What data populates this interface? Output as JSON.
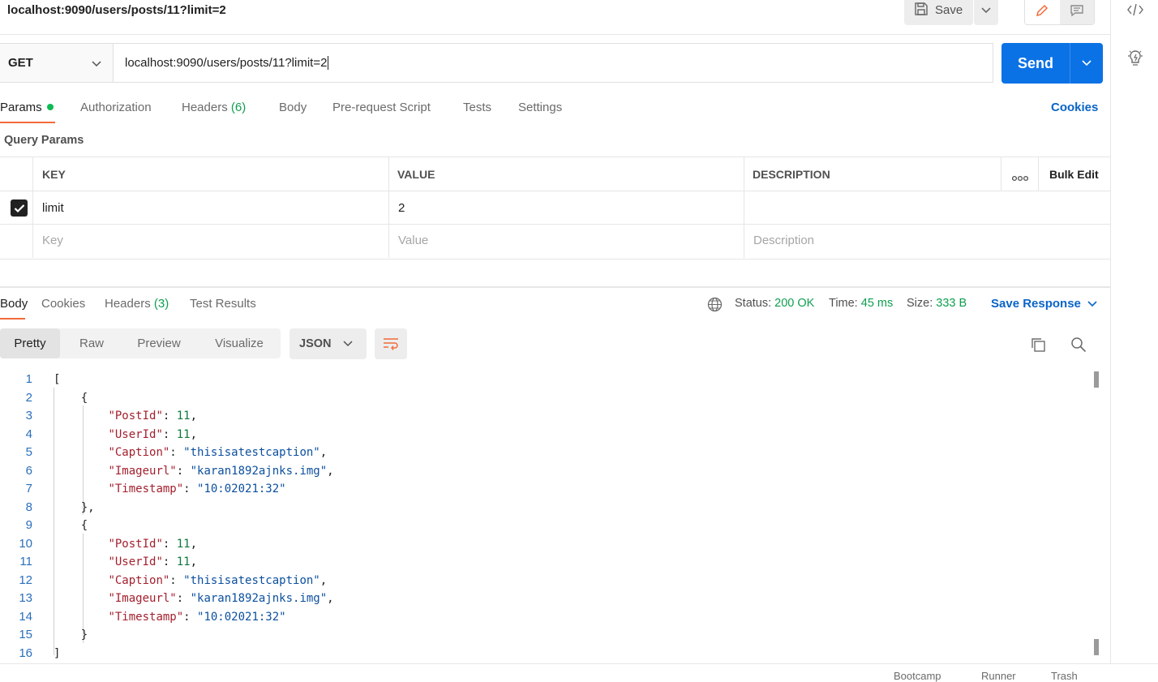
{
  "header": {
    "title": "localhost:9090/users/posts/11?limit=2",
    "save_label": "Save"
  },
  "request": {
    "method": "GET",
    "url": "localhost:9090/users/posts/11?limit=2",
    "send_label": "Send"
  },
  "request_tabs": {
    "params": "Params",
    "authorization": "Authorization",
    "headers": "Headers",
    "headers_count": "(6)",
    "body": "Body",
    "prerequest": "Pre-request Script",
    "tests": "Tests",
    "settings": "Settings",
    "cookies": "Cookies"
  },
  "query_params": {
    "title": "Query Params",
    "columns": {
      "key": "KEY",
      "value": "VALUE",
      "description": "DESCRIPTION",
      "bulk_edit": "Bulk Edit"
    },
    "rows": [
      {
        "key": "limit",
        "value": "2",
        "description": ""
      }
    ],
    "placeholders": {
      "key": "Key",
      "value": "Value",
      "description": "Description"
    }
  },
  "response_tabs": {
    "body": "Body",
    "cookies": "Cookies",
    "headers": "Headers",
    "headers_count": "(3)",
    "test_results": "Test Results"
  },
  "response_meta": {
    "status_label": "Status:",
    "status_value": "200 OK",
    "time_label": "Time:",
    "time_value": "45 ms",
    "size_label": "Size:",
    "size_value": "333 B",
    "save_response": "Save Response"
  },
  "view": {
    "pretty": "Pretty",
    "raw": "Raw",
    "preview": "Preview",
    "visualize": "Visualize",
    "format": "JSON"
  },
  "code_lines": [
    {
      "n": "1",
      "html": "["
    },
    {
      "n": "2",
      "html": "    {"
    },
    {
      "n": "3",
      "html": "        <span class='k'>\"PostId\"</span>: <span class='n'>11</span>,"
    },
    {
      "n": "4",
      "html": "        <span class='k'>\"UserId\"</span>: <span class='n'>11</span>,"
    },
    {
      "n": "5",
      "html": "        <span class='k'>\"Caption\"</span>: <span class='s'>\"thisisatestcaption\"</span>,"
    },
    {
      "n": "6",
      "html": "        <span class='k'>\"Imageurl\"</span>: <span class='s'>\"karan1892ajnks.img\"</span>,"
    },
    {
      "n": "7",
      "html": "        <span class='k'>\"Timestamp\"</span>: <span class='s'>\"10:02021:32\"</span>"
    },
    {
      "n": "8",
      "html": "    },"
    },
    {
      "n": "9",
      "html": "    {"
    },
    {
      "n": "10",
      "html": "        <span class='k'>\"PostId\"</span>: <span class='n'>11</span>,"
    },
    {
      "n": "11",
      "html": "        <span class='k'>\"UserId\"</span>: <span class='n'>11</span>,"
    },
    {
      "n": "12",
      "html": "        <span class='k'>\"Caption\"</span>: <span class='s'>\"thisisatestcaption\"</span>,"
    },
    {
      "n": "13",
      "html": "        <span class='k'>\"Imageurl\"</span>: <span class='s'>\"karan1892ajnks.img\"</span>,"
    },
    {
      "n": "14",
      "html": "        <span class='k'>\"Timestamp\"</span>: <span class='s'>\"10:02021:32\"</span>"
    },
    {
      "n": "15",
      "html": "    }"
    },
    {
      "n": "16",
      "html": "]"
    }
  ],
  "bottom_bar": {
    "bootcamp": "Bootcamp",
    "runner": "Runner",
    "trash": "Trash"
  },
  "colors": {
    "accent": "#f26b3a",
    "send": "#0a72e5",
    "success": "#0e9f4f",
    "link": "#0a64c8"
  },
  "icons": [
    "save-icon",
    "chevron-down-icon",
    "pencil-icon",
    "comment-icon",
    "code-icon",
    "lightbulb-icon",
    "globe-icon",
    "copy-icon",
    "search-icon",
    "wrap-icon",
    "check-icon"
  ]
}
